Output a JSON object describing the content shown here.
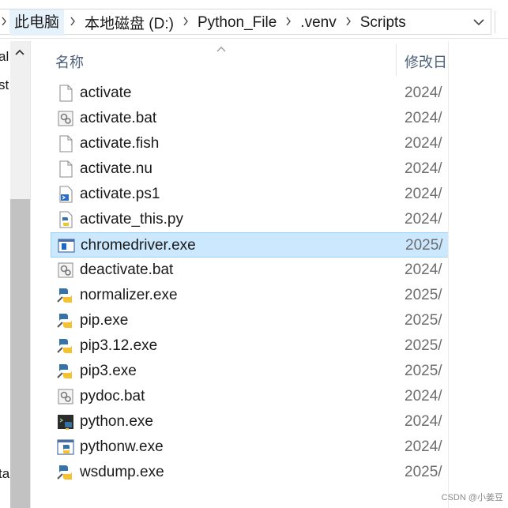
{
  "address_bar": {
    "breadcrumbs": [
      "此电脑",
      "本地磁盘 (D:)",
      "Python_File",
      ".venv",
      "Scripts"
    ]
  },
  "nav_pane": {
    "visible_fragments": [
      "al",
      "st",
      "ta"
    ]
  },
  "columns": {
    "name": "名称",
    "date_modified": "修改日"
  },
  "files": [
    {
      "name": "activate",
      "date": "2024/",
      "icon": "blank-file-icon",
      "selected": false
    },
    {
      "name": "activate.bat",
      "date": "2024/",
      "icon": "batch-file-icon",
      "selected": false
    },
    {
      "name": "activate.fish",
      "date": "2024/",
      "icon": "blank-file-icon",
      "selected": false
    },
    {
      "name": "activate.nu",
      "date": "2024/",
      "icon": "blank-file-icon",
      "selected": false
    },
    {
      "name": "activate.ps1",
      "date": "2024/",
      "icon": "powershell-script-icon",
      "selected": false
    },
    {
      "name": "activate_this.py",
      "date": "2024/",
      "icon": "python-file-icon",
      "selected": false
    },
    {
      "name": "chromedriver.exe",
      "date": "2025/",
      "icon": "application-exe-icon",
      "selected": true
    },
    {
      "name": "deactivate.bat",
      "date": "2024/",
      "icon": "batch-file-icon",
      "selected": false
    },
    {
      "name": "normalizer.exe",
      "date": "2025/",
      "icon": "python-exe-icon",
      "selected": false
    },
    {
      "name": "pip.exe",
      "date": "2025/",
      "icon": "python-exe-icon",
      "selected": false
    },
    {
      "name": "pip3.12.exe",
      "date": "2025/",
      "icon": "python-exe-icon",
      "selected": false
    },
    {
      "name": "pip3.exe",
      "date": "2025/",
      "icon": "python-exe-icon",
      "selected": false
    },
    {
      "name": "pydoc.bat",
      "date": "2024/",
      "icon": "batch-file-icon",
      "selected": false
    },
    {
      "name": "python.exe",
      "date": "2024/",
      "icon": "python-console-exe-icon",
      "selected": false
    },
    {
      "name": "pythonw.exe",
      "date": "2024/",
      "icon": "python-window-exe-icon",
      "selected": false
    },
    {
      "name": "wsdump.exe",
      "date": "2025/",
      "icon": "python-exe-icon",
      "selected": false
    }
  ],
  "watermark": "CSDN @小姜豆",
  "colors": {
    "selection_bg": "#cce8ff",
    "selection_border": "#99d1ff",
    "header_text": "#4c607a",
    "date_text": "#6d6d6d"
  }
}
